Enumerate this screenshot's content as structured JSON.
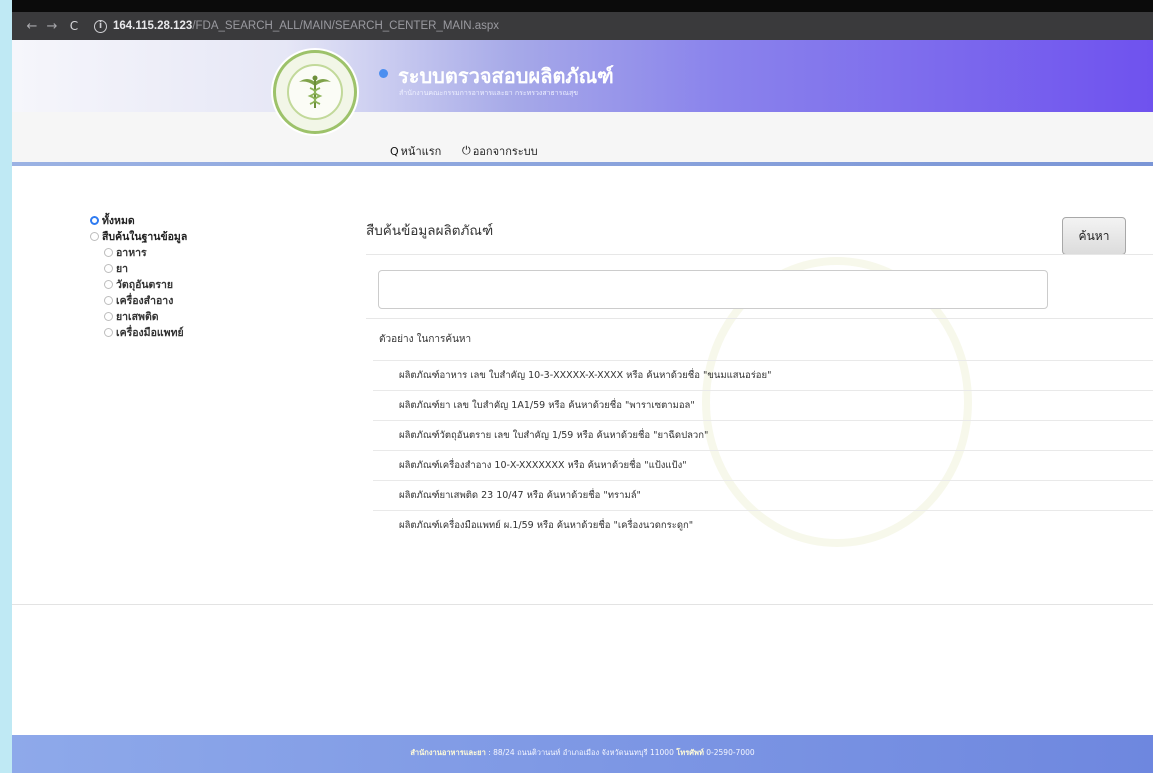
{
  "browser": {
    "back_glyph": "←",
    "forward_glyph": "→",
    "reload_glyph": "C",
    "url_host": "164.115.28.123",
    "url_path": "/FDA_SEARCH_ALL/MAIN/SEARCH_CENTER_MAIN.aspx"
  },
  "header": {
    "title": "ระบบตรวจสอบผลิตภัณฑ์",
    "subtitle": "สำนักงานคณะกรรมการอาหารและยา กระทรวงสาธารณสุข",
    "accent_color": "#6f52ee",
    "logo_icon": "caduceus-seal-icon"
  },
  "menu": {
    "home_icon": "search-icon",
    "home_label": "หน้าแรก",
    "logout_icon": "power-icon",
    "logout_label": "ออกจากระบบ"
  },
  "sidebar": {
    "all_label": "ทั้งหมด",
    "database_label": "สืบค้นในฐานข้อมูล",
    "items": [
      {
        "label": "อาหาร"
      },
      {
        "label": "ยา"
      },
      {
        "label": "วัตถุอันตราย"
      },
      {
        "label": "เครื่องสำอาง"
      },
      {
        "label": "ยาเสพติด"
      },
      {
        "label": "เครื่องมือแพทย์"
      }
    ]
  },
  "main": {
    "title": "สืบค้นข้อมูลผลิตภัณฑ์",
    "search_button": "ค้นหา",
    "search_value": "",
    "examples_header": "ตัวอย่าง ในการค้นหา",
    "examples": [
      "ผลิตภัณฑ์อาหาร เลข ใบสำคัญ 10-3-XXXXX-X-XXXX หรือ ค้นหาด้วยชื่อ \"ขนมแสนอร่อย\"",
      "ผลิตภัณฑ์ยา เลข ใบสำคัญ 1A1/59 หรือ ค้นหาด้วยชื่อ \"พาราเซตามอล\"",
      "ผลิตภัณฑ์วัตถุอันตราย เลข ใบสำคัญ 1/59 หรือ ค้นหาด้วยชื่อ \"ยาฉีดปลวก\"",
      "ผลิตภัณฑ์เครื่องสำอาง 10-X-XXXXXXX หรือ ค้นหาด้วยชื่อ \"แป้งแป้ง\"",
      "ผลิตภัณฑ์ยาเสพติด 23 10/47 หรือ ค้นหาด้วยชื่อ \"ทรามล์\"",
      "ผลิตภัณฑ์เครื่องมือแพทย์ ผ.1/59 หรือ ค้นหาด้วยชื่อ \"เครื่องนวดกระดูก\""
    ]
  },
  "footer": {
    "org": "สำนักงานอาหารและยา",
    "address": " : 88/24 ถนนติวานนท์ อำเภอเมือง จังหวัดนนทบุรี 11000 ",
    "phone_label": "โทรศัพท์",
    "phone": " 0-2590-7000"
  }
}
